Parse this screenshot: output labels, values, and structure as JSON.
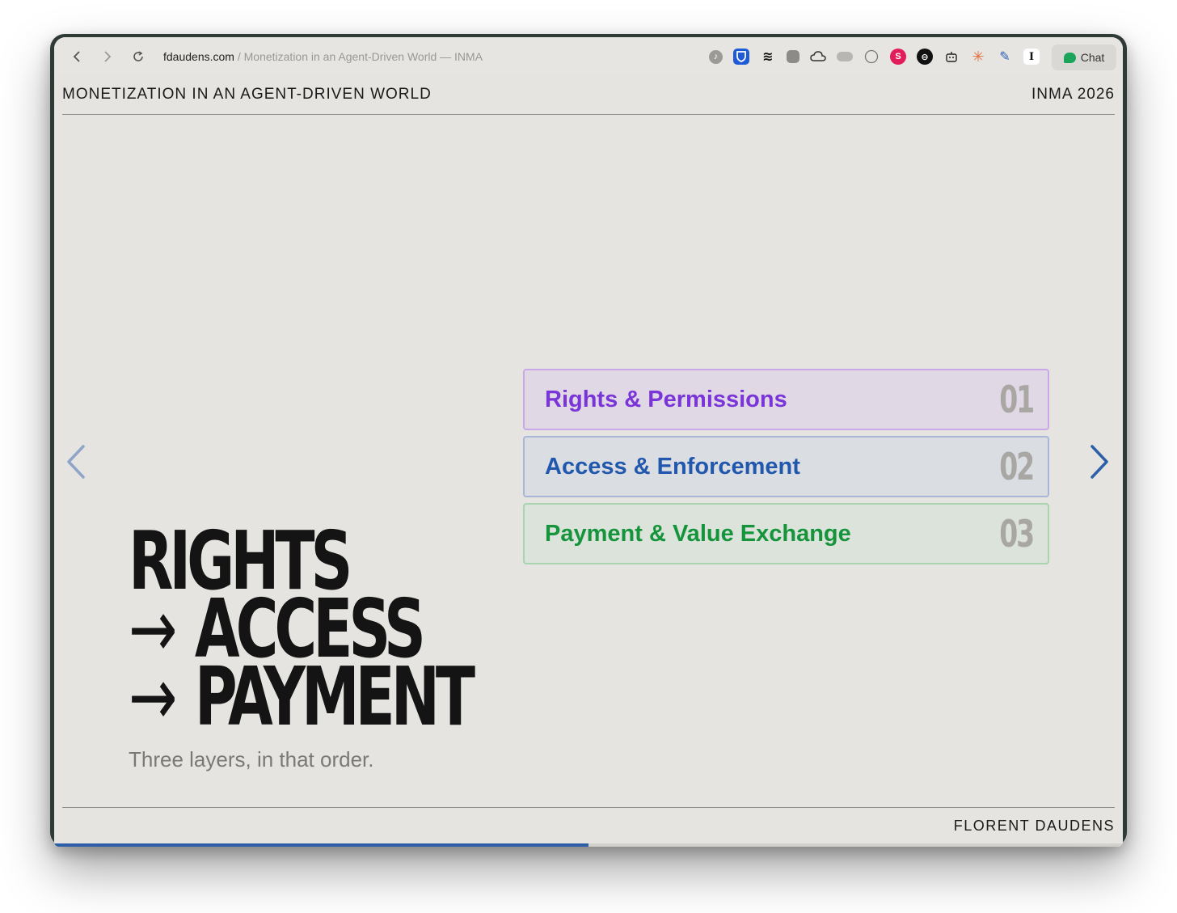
{
  "browser": {
    "domain": "fdaudens.com",
    "path": " / Monetization in an Agent-Driven World — INMA",
    "chat_label": "Chat",
    "extensions": [
      "music-icon",
      "bitwarden-icon",
      "buffer-icon",
      "copy-icon",
      "cloud-icon",
      "database-icon",
      "brain-icon",
      "s-icon",
      "circle-icon",
      "bot-icon",
      "burst-icon",
      "pencil-icon",
      "i-icon"
    ]
  },
  "slide": {
    "header_left": "MONETIZATION IN AN AGENT-DRIVEN WORLD",
    "header_right": "INMA 2026",
    "footer": "FLORENT DAUDENS",
    "heading": {
      "line1": "RIGHTS",
      "line2": "ACCESS",
      "line3": "PAYMENT",
      "arrow": "→"
    },
    "subtitle": "Three layers, in that order.",
    "cards": [
      {
        "label": "Rights & Permissions",
        "num": "01"
      },
      {
        "label": "Access & Enforcement",
        "num": "02"
      },
      {
        "label": "Payment & Value Exchange",
        "num": "03"
      }
    ],
    "progress": 0.5
  }
}
